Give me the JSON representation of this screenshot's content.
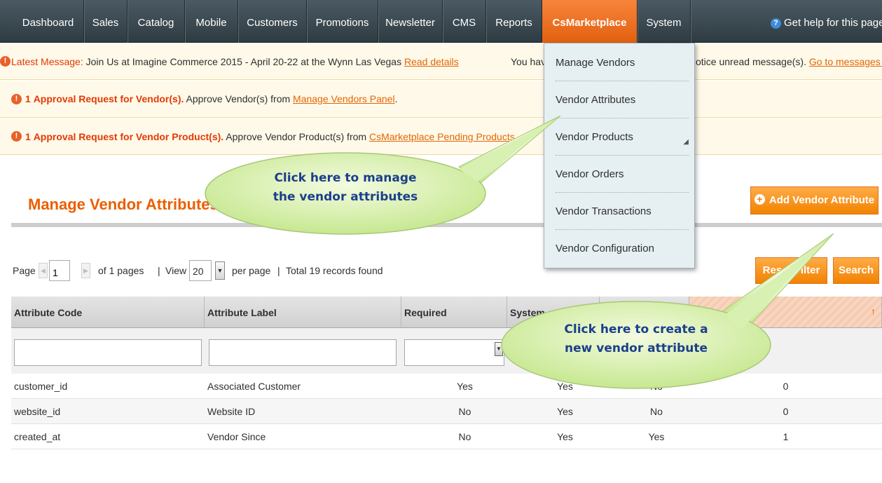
{
  "nav": {
    "items": [
      "Dashboard",
      "Sales",
      "Catalog",
      "Mobile",
      "Customers",
      "Promotions",
      "Newsletter",
      "CMS",
      "Reports",
      "CsMarketplace",
      "System"
    ],
    "active": "CsMarketplace",
    "help": "Get help for this page"
  },
  "messages": {
    "latest_label": "Latest Message:",
    "latest_text": "Join Us at Imagine Commerce 2015 - April 20-22 at the Wynn Las Vegas",
    "latest_link": "Read details",
    "you_have_prefix": "You have",
    "notice_suffix": "otice unread message(s).",
    "goto_link": "Go to messages inbox",
    "approval_vendor_count": "1",
    "approval_vendor_label": "Approval Request for Vendor(s).",
    "approval_vendor_text": "Approve Vendor(s) from",
    "approval_vendor_link": "Manage Vendors Panel",
    "approval_product_count": "1",
    "approval_product_label": "Approval Request for Vendor Product(s).",
    "approval_product_text": "Approve Vendor Product(s) from",
    "approval_product_link": "CsMarketplace Pending Products"
  },
  "menu": {
    "items": [
      "Manage Vendors",
      "Vendor Attributes",
      "Vendor Products",
      "Vendor Orders",
      "Vendor Transactions",
      "Vendor Configuration"
    ]
  },
  "page": {
    "title": "Manage Vendor Attributes",
    "add_button": "Add Vendor Attribute",
    "reset_button": "Reset Filter",
    "search_button": "Search"
  },
  "pager": {
    "page_label": "Page",
    "page_value": "1",
    "of_pages": "of 1 pages",
    "view_label": "View",
    "per_page_value": "20",
    "per_page_label": "per page",
    "total": "Total 19 records found"
  },
  "grid": {
    "columns": [
      "Attribute Code",
      "Attribute Label",
      "Required",
      "System",
      "",
      ""
    ],
    "rows": [
      [
        "customer_id",
        "Associated Customer",
        "Yes",
        "Yes",
        "No",
        "0"
      ],
      [
        "website_id",
        "Website ID",
        "No",
        "Yes",
        "No",
        "0"
      ],
      [
        "created_at",
        "Vendor Since",
        "No",
        "Yes",
        "Yes",
        "1"
      ]
    ]
  },
  "callouts": {
    "manage": [
      "Click here to manage",
      "the vendor attributes"
    ],
    "create": [
      "Click here to create a",
      "new vendor attribute"
    ]
  },
  "colors": {
    "nav_bg": "#3b4850",
    "accent_orange": "#eb5e00",
    "menu_bg": "#e6f0f2",
    "callout_fill": "#d8f0a8",
    "callout_text": "#1c3f8c"
  }
}
